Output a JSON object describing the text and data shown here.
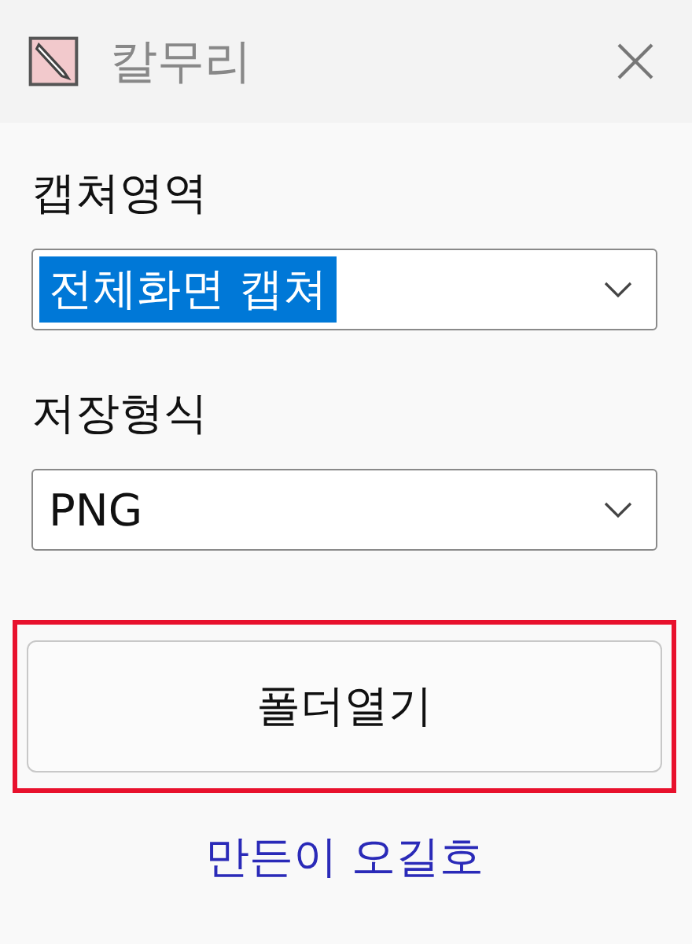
{
  "window": {
    "title": "칼무리"
  },
  "fields": [
    {
      "label": "캡쳐영역",
      "value": "전체화면 캡쳐",
      "focused": true
    },
    {
      "label": "저장형식",
      "value": "PNG",
      "focused": false
    }
  ],
  "button": {
    "label": "폴더열기",
    "highlighted": true
  },
  "credit": {
    "text": "만든이 오길호"
  }
}
